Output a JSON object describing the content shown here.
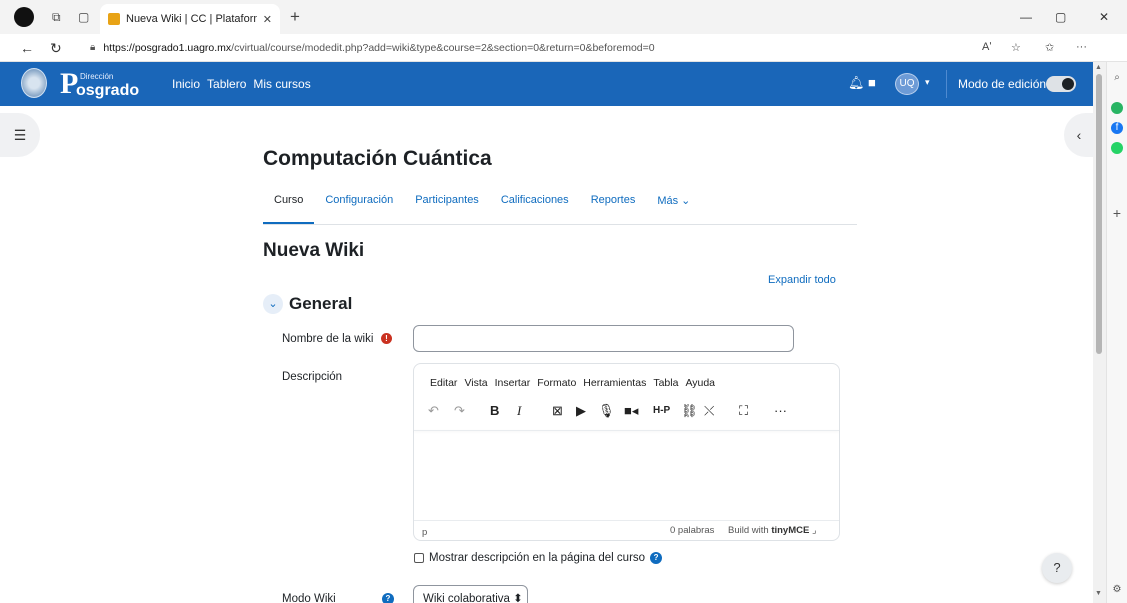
{
  "browser": {
    "tab_title": "Nueva Wiki | CC | Plataforma virtu",
    "tab_close": "✕",
    "new_tab": "+",
    "url_host": "https://posgrado1.uagro.mx",
    "url_path": "/cvirtual/course/modedit.php?add=wiki&type&course=2&section=0&return=0&beforemod=0",
    "read_aloud": "Aʹ",
    "more": "···",
    "win_minimize": "—",
    "win_restore": "▢",
    "win_close": "✕"
  },
  "navbar": {
    "logo_small": "Dirección",
    "logo_big": "osgrado",
    "logo_p": "P",
    "links": [
      "Inicio",
      "Tablero",
      "Mis cursos"
    ],
    "avatar": "UQ",
    "edit_mode_label": "Modo de edición"
  },
  "course": {
    "title": "Computación Cuántica",
    "tabs": [
      "Curso",
      "Configuración",
      "Participantes",
      "Calificaciones",
      "Reportes",
      "Más ⌄"
    ]
  },
  "page": {
    "title": "Nueva Wiki",
    "expand_all": "Expandir todo",
    "section_title": "General"
  },
  "form": {
    "wiki_name_label": "Nombre de la wiki",
    "description_label": "Descripción",
    "editor_menu": [
      "Editar",
      "Vista",
      "Insertar",
      "Formato",
      "Herramientas",
      "Tabla",
      "Ayuda"
    ],
    "editor_path": "p",
    "word_count": "0 palabras",
    "build_with": "Build with",
    "tinymce": "tinyMCE",
    "show_description_label": "Mostrar descripción en la página del curso",
    "wiki_mode_label": "Modo Wiki",
    "wiki_mode_value": "Wiki colaborativa ⬍"
  },
  "help_button": "?"
}
